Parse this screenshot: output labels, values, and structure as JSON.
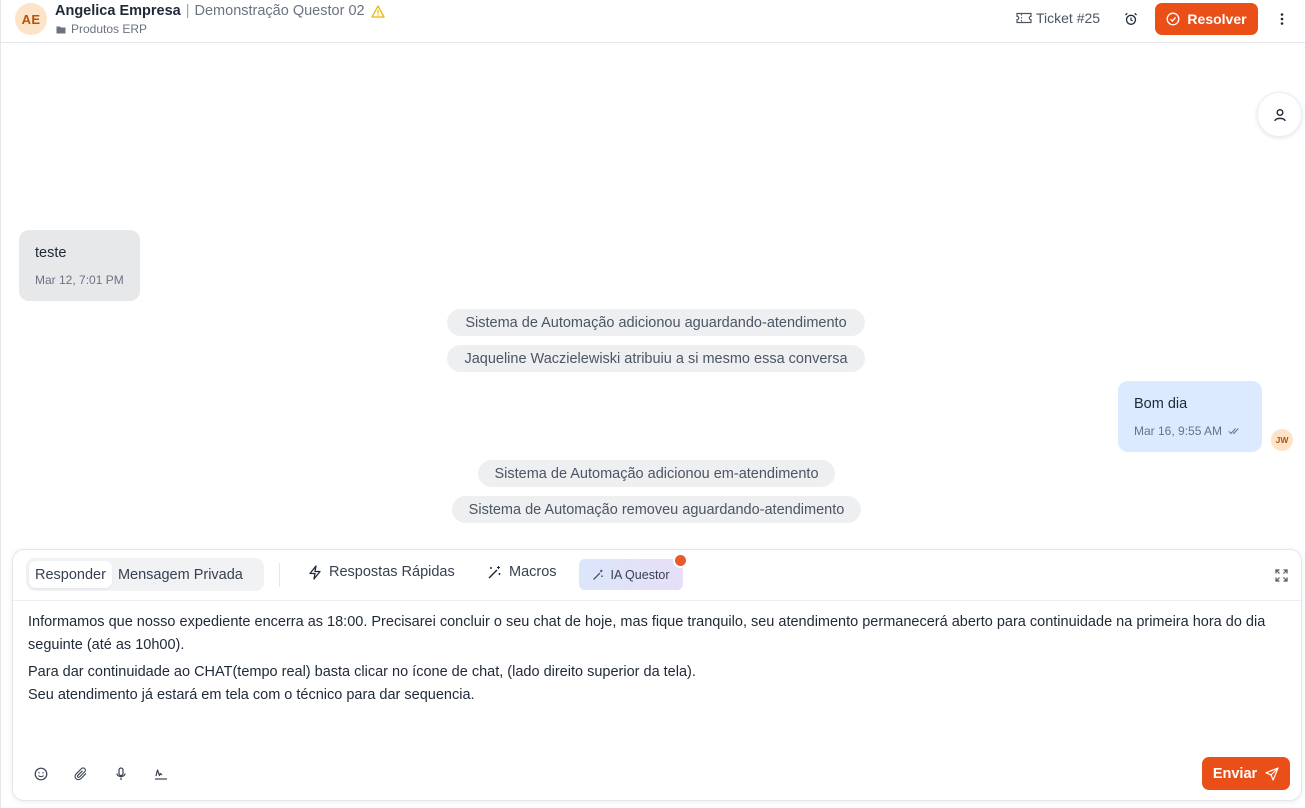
{
  "header": {
    "avatar_initials": "AE",
    "contact_name": "Angelica Empresa",
    "separator": "|",
    "inbox_name": "Demonstração Questor 02",
    "inbox_subtitle": "Produtos ERP",
    "ticket_label": "Ticket #25",
    "resolve_label": "Resolver",
    "icons": {
      "warning": "warning-icon",
      "folder": "folder-icon",
      "ticket": "ticket-icon",
      "alarm": "alarm-clock-icon",
      "resolve": "check-circle-icon",
      "more": "more-vertical-icon",
      "contact": "user-icon"
    }
  },
  "messages": [
    {
      "direction": "incoming",
      "text": "teste",
      "time": "Mar 12, 7:01 PM"
    },
    {
      "direction": "outgoing",
      "text": "Bom dia",
      "time": "Mar 16, 9:55 AM",
      "status_icon": "double-check-icon",
      "agent_initials": "JW"
    }
  ],
  "activities": [
    "Sistema de Automação adicionou aguardando-atendimento",
    "Jaqueline Waczielewiski atribuiu a si mesmo essa conversa",
    "Sistema de Automação adicionou em-atendimento",
    "Sistema de Automação removeu aguardando-atendimento"
  ],
  "composer": {
    "modes": [
      "Responder",
      "Mensagem Privada"
    ],
    "active_mode": "Responder",
    "tools": {
      "quick_replies": "Respostas Rápidas",
      "macros": "Macros",
      "ia": "IA Questor"
    },
    "editor_paragraphs": [
      "Informamos que nosso expediente encerra as 18:00. Precisarei concluir o seu chat de hoje, mas fique tranquilo, seu atendimento permanecerá aberto para continuidade na primeira hora do dia seguinte (até as 10h00).",
      "Para dar continuidade ao CHAT(tempo real) basta clicar no ícone de chat, (lado direito superior da tela).",
      "Seu atendimento já estará em tela com o técnico para dar sequencia."
    ],
    "send_label": "Enviar",
    "bottom_icons": [
      "emoji-icon",
      "attachment-icon",
      "microphone-icon",
      "signature-icon"
    ]
  },
  "colors": {
    "accent": "#ea4f18",
    "outgoing_bubble": "#dbeafe",
    "incoming_bubble": "#e7e8ea",
    "avatar_bg": "#fde3c8"
  }
}
